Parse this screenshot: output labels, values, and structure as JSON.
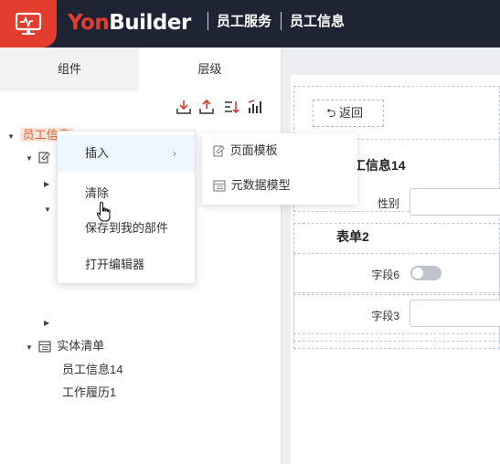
{
  "header": {
    "logo_icon": "monitor-icon",
    "brand_yon": "Yon",
    "brand_builder": "Builder",
    "nav_items": [
      "员工服务",
      "员工信息"
    ],
    "accent_color": "#e23d2e",
    "bg_color": "#1f2435"
  },
  "left_panel": {
    "tabs": [
      {
        "label": "组件",
        "active": false
      },
      {
        "label": "层级",
        "active": true
      }
    ],
    "toolbar_icons": [
      "download-icon",
      "upload-icon",
      "sort-icon",
      "bar-chart-icon"
    ],
    "tree": {
      "root_label": "员工信息",
      "child_label_fragment": "工",
      "entity_list_label": "实体清单",
      "entities": [
        "员工信息14",
        "工作履历1"
      ]
    }
  },
  "context_menu": {
    "items": [
      {
        "label": "插入",
        "has_submenu": true
      },
      {
        "label": "清除",
        "has_submenu": false
      },
      {
        "label": "保存到我的部件",
        "has_submenu": false
      },
      {
        "label": "打开编辑器",
        "has_submenu": false
      }
    ],
    "submenu": [
      {
        "label": "页面模板",
        "icon": "edit-doc-icon"
      },
      {
        "label": "元数据模型",
        "icon": "table-icon"
      }
    ]
  },
  "canvas": {
    "back_button_label": "返回",
    "form_title": "工信息14",
    "gender_label": "性别",
    "section2_title": "表单2",
    "field6_label": "字段6",
    "field3_label": "字段3"
  }
}
